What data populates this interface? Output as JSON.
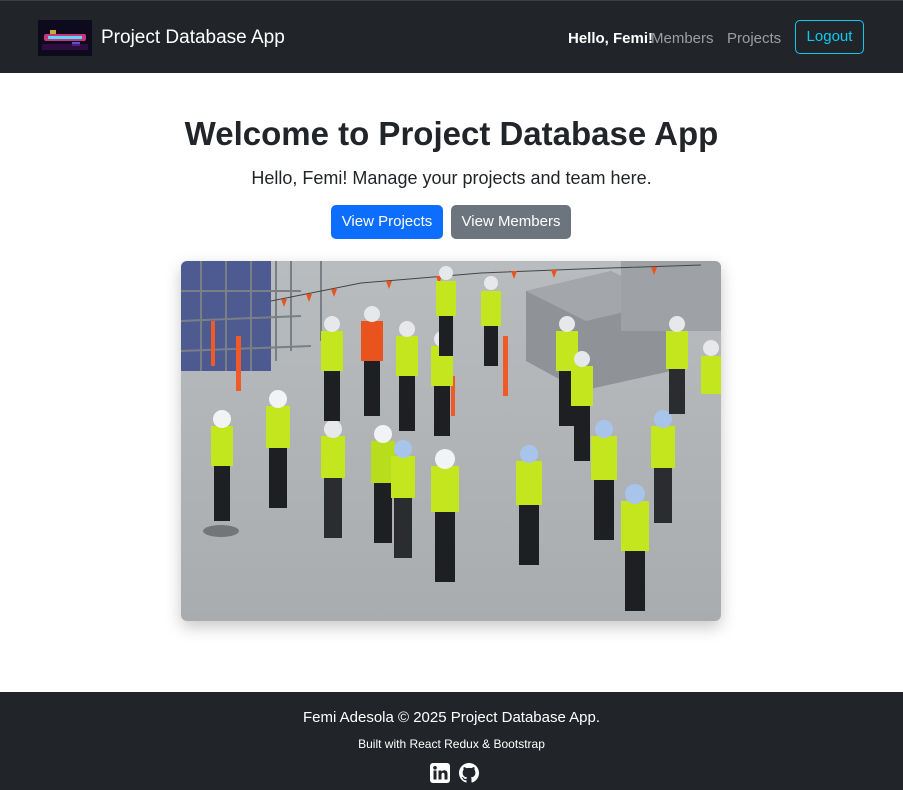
{
  "navbar": {
    "brand_title": "Project Database App",
    "greeting": "Hello, Femi!",
    "links": [
      "Members",
      "Projects"
    ],
    "logout_label": "Logout",
    "colors": {
      "background": "#212529",
      "logout_accent": "#0dcaf0"
    }
  },
  "hero": {
    "title": "Welcome to Project Database App",
    "subtitle": "Hello, Femi! Manage your projects and team here.",
    "primary_button": "View Projects",
    "secondary_button": "View Members",
    "colors": {
      "primary": "#0d6efd",
      "secondary": "#6c757d"
    }
  },
  "footer": {
    "copyright": "Femi Adesola © 2025 Project Database App.",
    "built_with": "Built with React Redux & Bootstrap",
    "icons": [
      "linkedin-icon",
      "github-icon"
    ]
  }
}
